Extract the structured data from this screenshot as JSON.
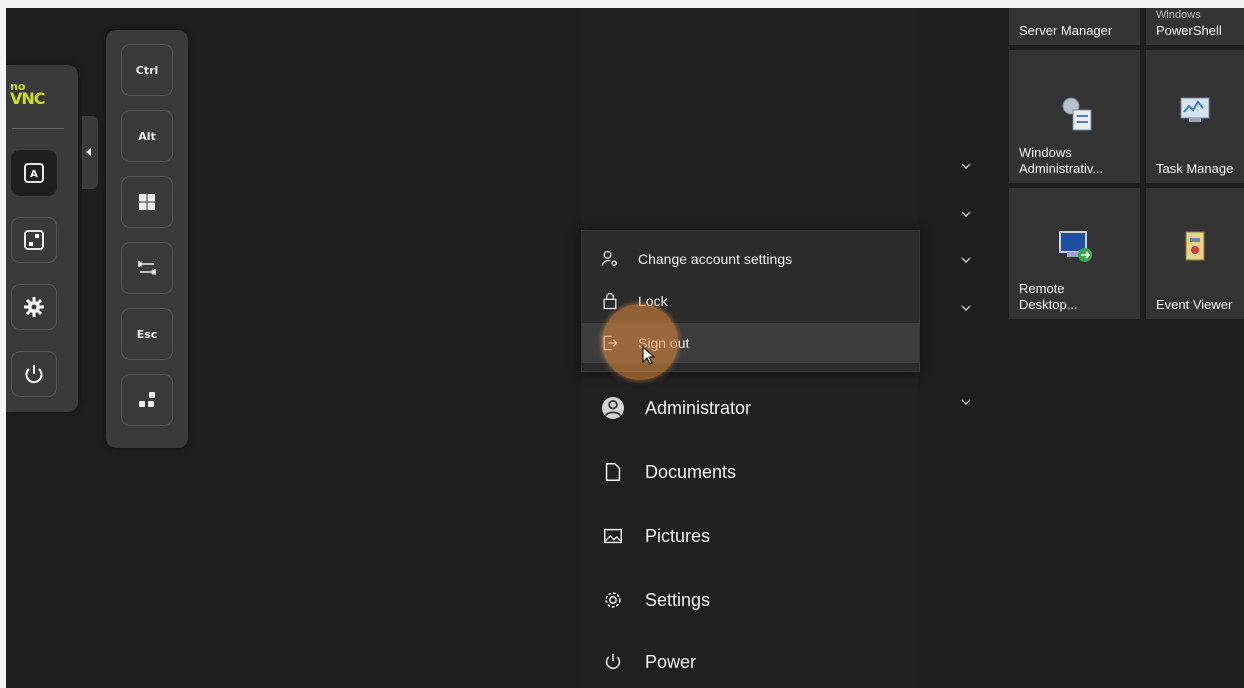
{
  "novnc": {
    "logo_no": "no",
    "logo_vnc": "VNC",
    "buttons": [
      {
        "name": "keyboard",
        "icon": "keyboard-a-icon",
        "active": true
      },
      {
        "name": "fullscreen",
        "icon": "fullscreen-icon"
      },
      {
        "name": "settings",
        "icon": "gear-icon"
      },
      {
        "name": "power",
        "icon": "power-icon"
      }
    ]
  },
  "extra_keys": {
    "ctrl": "Ctrl",
    "alt": "Alt",
    "windows": "windows-key-icon",
    "tab": "tab-key-icon",
    "esc": "Esc",
    "toggle": "dots-icon"
  },
  "account_popup": {
    "items": [
      {
        "label": "Change account settings",
        "icon": "account-settings-icon"
      },
      {
        "label": "Lock",
        "icon": "lock-icon"
      },
      {
        "label": "Sign out",
        "icon": "sign-out-icon",
        "highlighted": true
      }
    ]
  },
  "start_menu": {
    "items": [
      {
        "label": "Administrator",
        "icon": "user-avatar-icon"
      },
      {
        "label": "Documents",
        "icon": "document-icon"
      },
      {
        "label": "Pictures",
        "icon": "pictures-icon"
      },
      {
        "label": "Settings",
        "icon": "gear-icon"
      },
      {
        "label": "Power",
        "icon": "power-icon"
      }
    ]
  },
  "tiles": {
    "server_manager": "Server Manager",
    "powershell_top": "Windows",
    "powershell": "PowerShell",
    "admin_tools_1": "Windows",
    "admin_tools_2": "Administrativ...",
    "task_manager": "Task Manage",
    "remote_desktop_1": "Remote",
    "remote_desktop_2": "Desktop...",
    "event_viewer": "Event Viewer"
  },
  "colors": {
    "accent_ring": "#e68c3c",
    "novnc_logo": "#cde01c",
    "background": "#1e1e1e"
  }
}
